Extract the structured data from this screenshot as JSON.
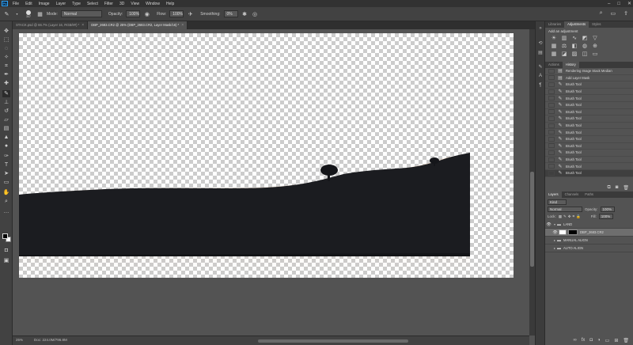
{
  "app": {
    "logo": "Ps"
  },
  "menu": [
    "File",
    "Edit",
    "Image",
    "Layer",
    "Type",
    "Select",
    "Filter",
    "3D",
    "View",
    "Window",
    "Help"
  ],
  "window_controls": [
    "–",
    "□",
    "✕"
  ],
  "options": {
    "brush_size": "347",
    "mode_label": "Mode:",
    "mode_value": "Normal",
    "opacity_label": "Opacity:",
    "opacity_value": "100%",
    "flow_label": "Flow:",
    "flow_value": "100%",
    "smoothing_label": "Smoothing:",
    "smoothing_value": "0%"
  },
  "tabs": [
    {
      "label": "STACK.psd @ 66.7% (Layer 16, RGB/8#) *",
      "active": false
    },
    {
      "label": "DBP_2683.CR2 @ 25% (DBP_2683.CR2, Layer Mask/16) *",
      "active": true
    }
  ],
  "status": {
    "zoom": "25%",
    "doc": "Doc: 224.0M/796.8M"
  },
  "colors": {
    "accent": "#2fa3f6",
    "panel": "#535353",
    "chrome": "#424242"
  },
  "adjustments_panel": {
    "tabs": [
      "Libraries",
      "Adjustments",
      "Styles"
    ],
    "active_tab": "Adjustments",
    "title": "Add an adjustment",
    "icons": [
      "brightness-icon",
      "levels-icon",
      "curves-icon",
      "exposure-icon",
      "vibrance-icon",
      "hue-icon",
      "color-balance-icon",
      "black-white-icon",
      "photo-filter-icon",
      "channel-mixer-icon",
      "lookup-icon",
      "invert-icon",
      "posterize-icon",
      "threshold-icon",
      "gradient-map-icon",
      "selective-color-icon"
    ]
  },
  "history_panel": {
    "tabs": [
      "Actions",
      "History"
    ],
    "active_tab": "History",
    "items": [
      "Rendering Image Stack Median",
      "Add Layer Mask",
      "Brush Tool",
      "Brush Tool",
      "Brush Tool",
      "Brush Tool",
      "Brush Tool",
      "Brush Tool",
      "Brush Tool",
      "Brush Tool",
      "Brush Tool",
      "Brush Tool",
      "Brush Tool",
      "Brush Tool",
      "Brush Tool",
      "Brush Tool"
    ]
  },
  "layers_panel": {
    "tabs": [
      "Layers",
      "Channels",
      "Paths"
    ],
    "active_tab": "Layers",
    "filter_value": "Kind",
    "blend_mode": "Normal",
    "opacity_label": "Opacity:",
    "opacity_value": "100%",
    "lock_label": "Lock:",
    "fill_label": "Fill:",
    "fill_value": "100%",
    "layers": [
      {
        "name": "LAND",
        "type": "group",
        "visible": true,
        "active": false
      },
      {
        "name": "DBP_2683.CR2",
        "type": "layer",
        "visible": true,
        "active": true
      },
      {
        "name": "MANUAL ALIGN",
        "type": "group",
        "visible": false,
        "active": false
      },
      {
        "name": "AUTO ALIGN",
        "type": "group",
        "visible": false,
        "active": false
      }
    ]
  }
}
